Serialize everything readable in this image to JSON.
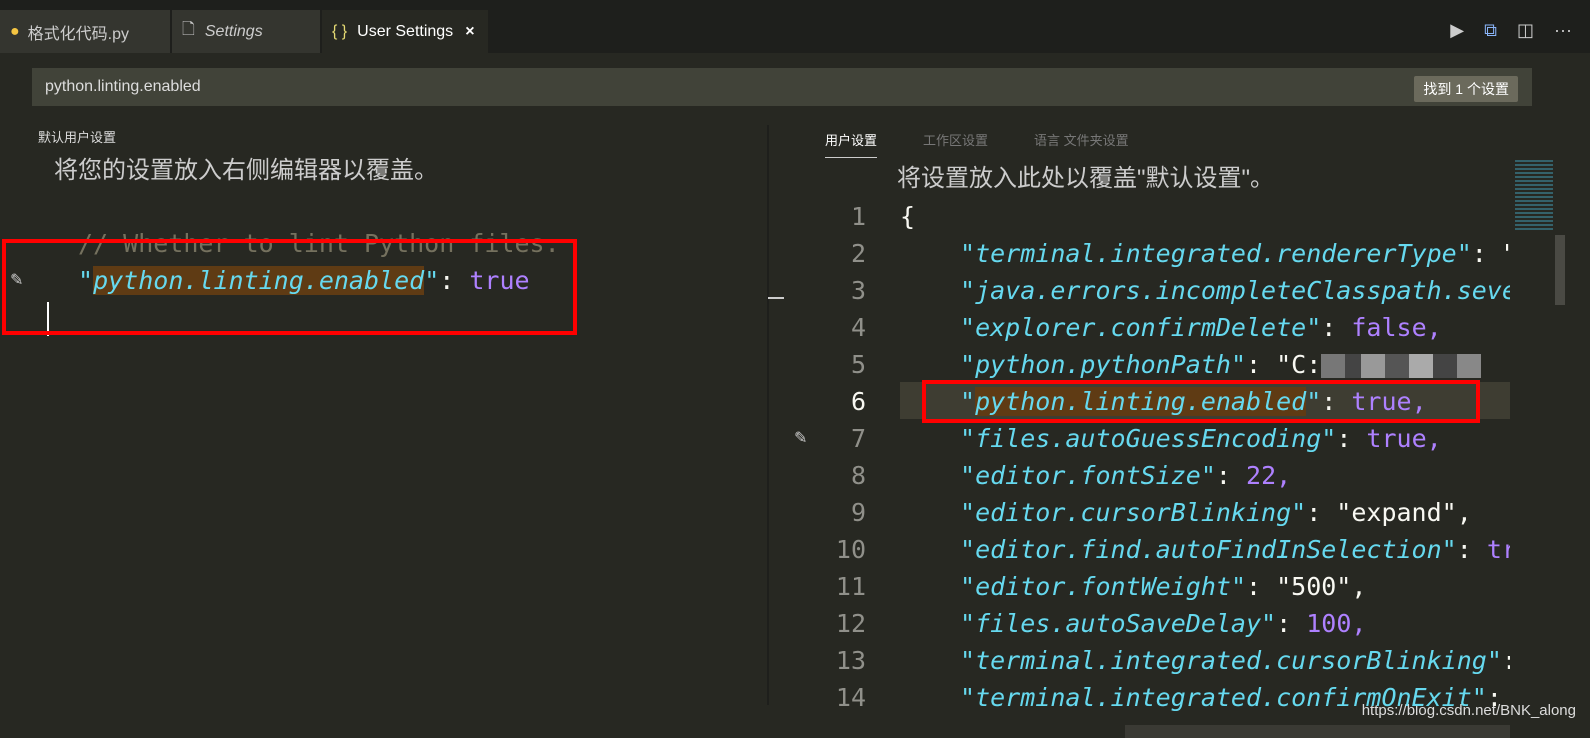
{
  "tabs": [
    {
      "label": "格式化代码.py",
      "icon": "python-icon"
    },
    {
      "label": "Settings",
      "icon": "file-icon"
    },
    {
      "label": "User Settings",
      "icon": "braces-icon",
      "active": true
    }
  ],
  "actions": [
    "run-icon",
    "open-preview-icon",
    "split-editor-icon",
    "more-icon"
  ],
  "search": {
    "value": "python.linting.enabled",
    "result": "找到 1 个设置"
  },
  "left": {
    "title": "默认用户设置",
    "hint": "将您的设置放入右侧编辑器以覆盖。",
    "comment": "// Whether to lint Python files.",
    "key": "python.linting.enabled",
    "value": "true"
  },
  "right": {
    "tabs": [
      "用户设置",
      "工作区设置",
      "语言",
      "文件夹设置"
    ],
    "hint": "将设置放入此处以覆盖\"默认设置\"。",
    "lines": [
      {
        "n": "1",
        "k": "",
        "v": "{"
      },
      {
        "n": "2",
        "k": "terminal.integrated.rendererType",
        "v": ": \"c"
      },
      {
        "n": "3",
        "k": "java.errors.incompleteClasspath.sever",
        "v": ""
      },
      {
        "n": "4",
        "k": "explorer.confirmDelete",
        "v": ": ",
        "lit": "false,"
      },
      {
        "n": "5",
        "k": "python.pythonPath",
        "v": ": \"C:",
        "blur": true
      },
      {
        "n": "6",
        "k": "python.linting.enabled",
        "v": ": ",
        "lit": "true,",
        "hl": true
      },
      {
        "n": "7",
        "k": "files.autoGuessEncoding",
        "v": ": ",
        "lit": "true,"
      },
      {
        "n": "8",
        "k": "editor.fontSize",
        "v": ": ",
        "lit": "22,"
      },
      {
        "n": "9",
        "k": "editor.cursorBlinking",
        "v": ": \"expand\","
      },
      {
        "n": "10",
        "k": "editor.find.autoFindInSelection",
        "v": ": ",
        "lit": "tru"
      },
      {
        "n": "11",
        "k": "editor.fontWeight",
        "v": ": \"500\","
      },
      {
        "n": "12",
        "k": "files.autoSaveDelay",
        "v": ": ",
        "lit": "100,"
      },
      {
        "n": "13",
        "k": "terminal.integrated.cursorBlinking",
        "v": ":"
      },
      {
        "n": "14",
        "k": "terminal.integrated.confirmOnExit",
        "v": ": ",
        "lit": "t"
      }
    ]
  },
  "watermark": "https://blog.csdn.net/BNK_along"
}
